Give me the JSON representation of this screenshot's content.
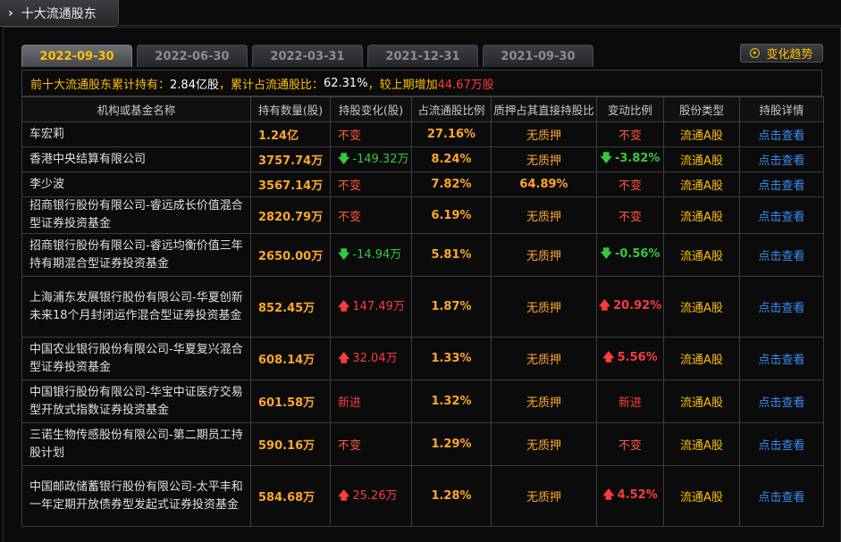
{
  "header": {
    "title": "十大流通股东",
    "chevron_icon": "chevron-right-icon"
  },
  "tabs": [
    {
      "label": "2022-09-30",
      "active": true
    },
    {
      "label": "2022-06-30",
      "active": false
    },
    {
      "label": "2022-03-31",
      "active": false
    },
    {
      "label": "2021-12-31",
      "active": false
    },
    {
      "label": "2021-09-30",
      "active": false
    }
  ],
  "trend_button": {
    "label": "变化趋势",
    "icon": "play-circle-icon"
  },
  "summary": {
    "prefix": "前十大流通股东累计持有：",
    "held": "2.84亿股",
    "mid": "，累计占流通股比：",
    "ratio": "62.31%",
    "mid2": "，较上期增加",
    "increase": "44.67万股"
  },
  "table": {
    "headers": [
      "机构或基金名称",
      "持有数量(股)",
      "持股变化(股)",
      "占流通股比例",
      "质押占其直接持股比",
      "变动比例",
      "股份类型",
      "持股详情"
    ],
    "rows": [
      {
        "name": "车宏莉",
        "qty": "1.24亿",
        "change": "不变",
        "change_dir": "none",
        "pct": "27.16%",
        "pledge": "无质押",
        "chg_ratio": "不变",
        "ratio_dir": "none",
        "type": "流通A股",
        "detail": "点击查看"
      },
      {
        "name": "香港中央结算有限公司",
        "qty": "3757.74万",
        "change": "-149.32万",
        "change_dir": "down",
        "pct": "8.24%",
        "pledge": "无质押",
        "chg_ratio": "-3.82%",
        "ratio_dir": "down",
        "type": "流通A股",
        "detail": "点击查看"
      },
      {
        "name": "李少波",
        "qty": "3567.14万",
        "change": "不变",
        "change_dir": "none",
        "pct": "7.82%",
        "pledge": "64.89%",
        "chg_ratio": "不变",
        "ratio_dir": "none",
        "type": "流通A股",
        "detail": "点击查看"
      },
      {
        "name": "招商银行股份有限公司-睿远成长价值混合型证券投资基金",
        "qty": "2820.79万",
        "change": "不变",
        "change_dir": "none",
        "pct": "6.19%",
        "pledge": "无质押",
        "chg_ratio": "不变",
        "ratio_dir": "none",
        "type": "流通A股",
        "detail": "点击查看"
      },
      {
        "name": "招商银行股份有限公司-睿远均衡价值三年持有期混合型证券投资基金",
        "qty": "2650.00万",
        "change": "-14.94万",
        "change_dir": "down",
        "pct": "5.81%",
        "pledge": "无质押",
        "chg_ratio": "-0.56%",
        "ratio_dir": "down",
        "type": "流通A股",
        "detail": "点击查看"
      },
      {
        "name": "上海浦东发展银行股份有限公司-华夏创新未来18个月封闭运作混合型证券投资基金",
        "qty": "852.45万",
        "change": "147.49万",
        "change_dir": "up",
        "pct": "1.87%",
        "pledge": "无质押",
        "chg_ratio": "20.92%",
        "ratio_dir": "up",
        "type": "流通A股",
        "detail": "点击查看"
      },
      {
        "name": "中国农业银行股份有限公司-华夏复兴混合型证券投资基金",
        "qty": "608.14万",
        "change": "32.04万",
        "change_dir": "up",
        "pct": "1.33%",
        "pledge": "无质押",
        "chg_ratio": "5.56%",
        "ratio_dir": "up",
        "type": "流通A股",
        "detail": "点击查看"
      },
      {
        "name": "中国银行股份有限公司-华宝中证医疗交易型开放式指数证券投资基金",
        "qty": "601.58万",
        "change": "新进",
        "change_dir": "new",
        "pct": "1.32%",
        "pledge": "无质押",
        "chg_ratio": "新进",
        "ratio_dir": "new",
        "type": "流通A股",
        "detail": "点击查看"
      },
      {
        "name": "三诺生物传感股份有限公司-第二期员工持股计划",
        "qty": "590.16万",
        "change": "不变",
        "change_dir": "none",
        "pct": "1.29%",
        "pledge": "无质押",
        "chg_ratio": "不变",
        "ratio_dir": "none",
        "type": "流通A股",
        "detail": "点击查看"
      },
      {
        "name": "中国邮政储蓄银行股份有限公司-太平丰和一年定期开放债券型发起式证券投资基金",
        "qty": "584.68万",
        "change": "25.26万",
        "change_dir": "up",
        "pct": "1.28%",
        "pledge": "无质押",
        "chg_ratio": "4.52%",
        "ratio_dir": "up",
        "type": "流通A股",
        "detail": "点击查看"
      }
    ]
  },
  "colors": {
    "accent": "#ffc000",
    "up": "#ff3b3b",
    "down": "#35c93c",
    "link": "#3d8df5",
    "value": "#ffa726"
  }
}
